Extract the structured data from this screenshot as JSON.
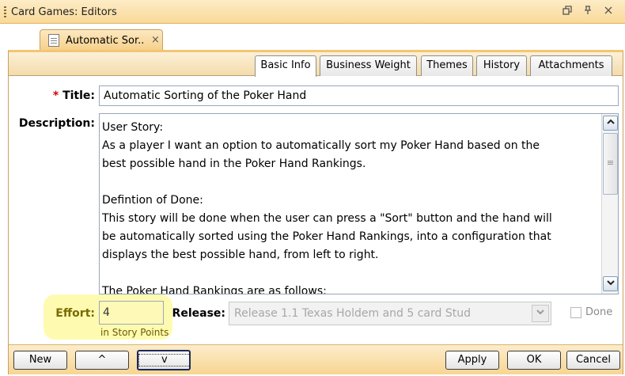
{
  "window": {
    "title": "Card Games: Editors",
    "controls": [
      "restore-icon",
      "pin-icon",
      "close-icon"
    ]
  },
  "doc_tab": {
    "label": "Automatic Sor..",
    "close": "×"
  },
  "subtabs": [
    "Basic Info",
    "Business Weight",
    "Themes",
    "History",
    "Attachments"
  ],
  "form": {
    "title_required_marker": "*",
    "title_label": "Title:",
    "title_value": "Automatic Sorting of the Poker Hand",
    "description_label": "Description:",
    "description_paragraphs": [
      "User Story:\nAs a player I want an option to automatically sort my Poker Hand based on the\nbest possible hand in the Poker Hand Rankings.",
      "Defintion of Done:\nThis story will be done when the user can press a \"Sort\" button and the hand will\nbe automatically sorted using the Poker Hand Rankings, into a configuration that\ndisplays the best possible hand, from left to right.",
      "The Poker Hand Rankings are as follows:"
    ],
    "effort_label": "Effort:",
    "effort_value": "4",
    "effort_unit": "in Story Points",
    "release_label": "Release:",
    "release_value": "Release 1.1 Texas Holdem and 5 card Stud",
    "done_label": "Done",
    "done_checked": false
  },
  "buttons": {
    "new": "New",
    "up": "^",
    "down": "v",
    "apply": "Apply",
    "ok": "OK",
    "cancel": "Cancel"
  },
  "colors": {
    "accent": "#f6d08b",
    "required": "#d40000",
    "highlight": "#fefbb0",
    "effort_label": "#7a6a00"
  }
}
